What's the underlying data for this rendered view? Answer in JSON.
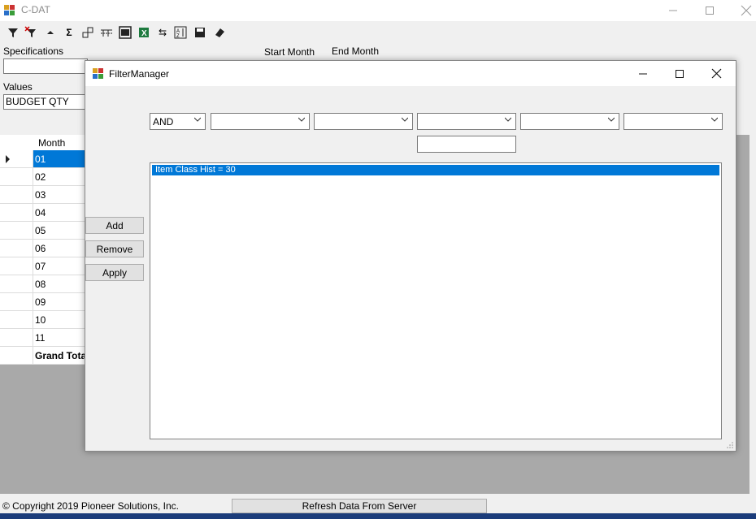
{
  "app": {
    "title": "C-DAT",
    "window_controls": [
      "minimize",
      "maximize",
      "close"
    ]
  },
  "toolbar": {
    "icons": [
      "filter-icon",
      "clear-filter-icon",
      "sort-up-icon",
      "sum-icon",
      "pivot-icon",
      "columns-icon",
      "layout-icon",
      "excel-icon",
      "swap-icon",
      "sort-icon",
      "save-icon",
      "eraser-icon"
    ]
  },
  "form": {
    "specifications_label": "Specifications",
    "specifications_value": "",
    "values_label": "Values",
    "values_value": "BUDGET QTY",
    "start_month_label": "Start Month",
    "end_month_label": "End Month"
  },
  "grid": {
    "header": "Month",
    "rows": [
      "01",
      "02",
      "03",
      "04",
      "05",
      "06",
      "07",
      "08",
      "09",
      "10",
      "11"
    ],
    "total_label": "Grand Total"
  },
  "dialog": {
    "title": "FilterManager",
    "combos": [
      "AND",
      "",
      "",
      "",
      "",
      ""
    ],
    "value_text": "",
    "buttons": {
      "add": "Add",
      "remove": "Remove",
      "apply": "Apply"
    },
    "filters": [
      "Item Class Hist = 30"
    ]
  },
  "status": {
    "copyright": "© Copyright 2019 Pioneer Solutions, Inc.",
    "refresh_button": "Refresh Data From Server"
  },
  "colors": {
    "selection": "#0078d7",
    "background": "#f0f0f0",
    "gray_area": "#a9a9a9"
  }
}
